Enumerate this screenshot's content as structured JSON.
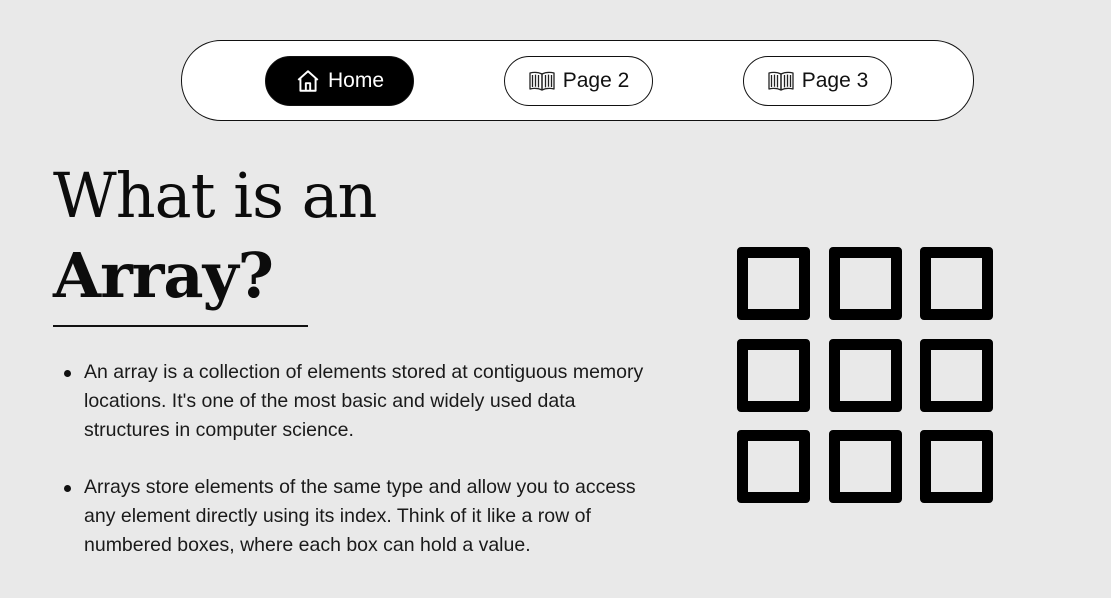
{
  "nav": {
    "items": [
      {
        "label": "Home",
        "icon": "home-icon",
        "active": true
      },
      {
        "label": "Page 2",
        "icon": "book-icon",
        "active": false
      },
      {
        "label": "Page 3",
        "icon": "book-icon",
        "active": false
      }
    ]
  },
  "hero": {
    "title_line1": "What is an",
    "title_line2": "Array?"
  },
  "bullets": [
    "An array is a collection of elements stored at contiguous memory locations. It's one of the most basic and widely used data structures in computer science.",
    "Arrays store elements of the same type and allow you to access any element directly using its index. Think of it like a row of numbered boxes, where each box can hold a value."
  ],
  "illustration": {
    "icon": "array-grid-icon",
    "rows": 3,
    "columns": 3
  },
  "colors": {
    "background": "#e9e9e9",
    "nav_active": "#000000",
    "text": "#111111"
  }
}
